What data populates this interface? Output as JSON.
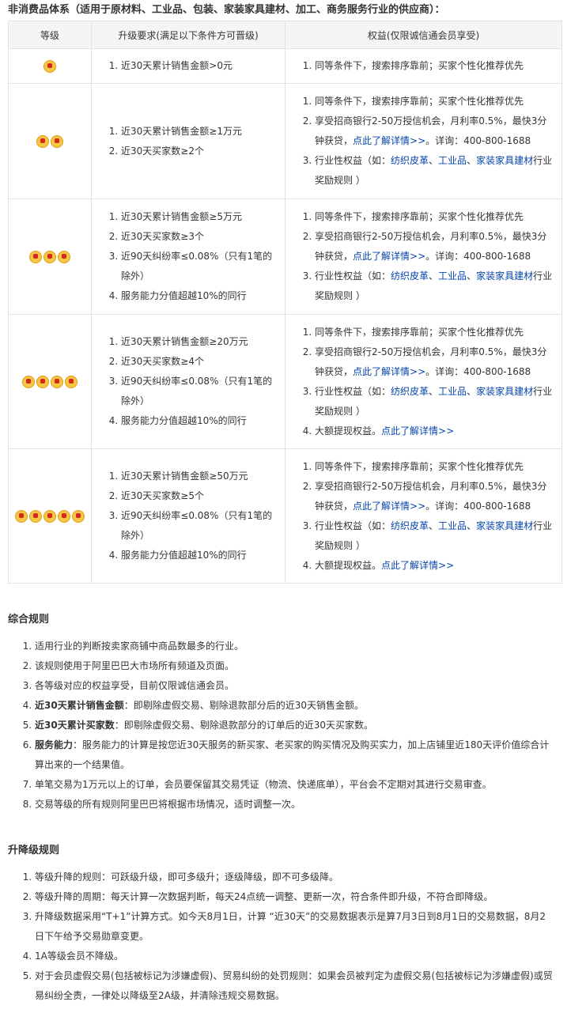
{
  "title": "非消费品体系（适用于原材料、工业品、包装、家装家具建材、加工、商务服务行业的供应商）：",
  "table": {
    "headers": [
      "等级",
      "升级要求(满足以下条件方可晋级)",
      "权益(仅限诚信通会员享受)"
    ],
    "rows": [
      {
        "crowns": 1,
        "requirements": [
          "近30天累计销售金额>0元"
        ],
        "benefits": [
          {
            "text": "同等条件下，搜索排序靠前；买家个性化推荐优先"
          }
        ]
      },
      {
        "crowns": 2,
        "requirements": [
          "近30天累计销售金额≥1万元",
          "近30天买家数≥2个"
        ],
        "benefits": [
          {
            "text": "同等条件下，搜索排序靠前；买家个性化推荐优先"
          },
          {
            "pre": "享受招商银行2-50万授信机会，月利率0.5%，最快3分钟获贷，",
            "link": "点此了解详情>>",
            "post": "。详询：400-800-1688"
          },
          {
            "pre": "行业性权益（如：",
            "links": [
              "纺织皮革",
              "工业品",
              "家装家具建材"
            ],
            "seps": [
              "、",
              "、"
            ],
            "post": "行业奖励规则 ）"
          }
        ]
      },
      {
        "crowns": 3,
        "requirements": [
          "近30天累计销售金额≥5万元",
          "近30天买家数≥3个",
          "近90天纠纷率≤0.08%（只有1笔的除外）",
          "服务能力分值超越10%的同行"
        ],
        "benefits": [
          {
            "text": "同等条件下，搜索排序靠前；买家个性化推荐优先"
          },
          {
            "pre": "享受招商银行2-50万授信机会，月利率0.5%，最快3分钟获贷，",
            "link": "点此了解详情>>",
            "post": "。详询：400-800-1688"
          },
          {
            "pre": "行业性权益（如：",
            "links": [
              "纺织皮革",
              "工业品",
              "家装家具建材"
            ],
            "seps": [
              "、",
              "、"
            ],
            "post": "行业奖励规则 ）"
          }
        ]
      },
      {
        "crowns": 4,
        "requirements": [
          "近30天累计销售金额≥20万元",
          "近30天买家数≥4个",
          "近90天纠纷率≤0.08%（只有1笔的除外）",
          "服务能力分值超越10%的同行"
        ],
        "benefits": [
          {
            "text": "同等条件下，搜索排序靠前；买家个性化推荐优先"
          },
          {
            "pre": "享受招商银行2-50万授信机会，月利率0.5%，最快3分钟获贷，",
            "link": "点此了解详情>>",
            "post": "。详询：400-800-1688"
          },
          {
            "pre": "行业性权益（如：",
            "links": [
              "纺织皮革",
              "工业品",
              "家装家具建材"
            ],
            "seps": [
              "、",
              "、"
            ],
            "post": "行业奖励规则 ）"
          },
          {
            "pre": "大额提现权益。",
            "link": "点此了解详情>>",
            "post": ""
          }
        ]
      },
      {
        "crowns": 5,
        "requirements": [
          "近30天累计销售金额≥50万元",
          "近30天买家数≥5个",
          "近90天纠纷率≤0.08%（只有1笔的除外）",
          "服务能力分值超越10%的同行"
        ],
        "benefits": [
          {
            "text": "同等条件下，搜索排序靠前；买家个性化推荐优先"
          },
          {
            "pre": "享受招商银行2-50万授信机会，月利率0.5%，最快3分钟获贷，",
            "link": "点此了解详情>>",
            "post": "。详询：400-800-1688"
          },
          {
            "pre": "行业性权益（如：",
            "links": [
              "纺织皮革",
              "工业品",
              "家装家具建材"
            ],
            "seps": [
              "、",
              "、"
            ],
            "post": "行业奖励规则 ）"
          },
          {
            "pre": "大额提现权益。",
            "link": "点此了解详情>>",
            "post": ""
          }
        ]
      }
    ]
  },
  "general_rules": {
    "heading": "综合规则",
    "items": [
      {
        "text": "适用行业的判断按卖家商铺中商品数最多的行业。"
      },
      {
        "text": "该规则使用于阿里巴巴大市场所有频道及页面。"
      },
      {
        "text": "各等级对应的权益享受，目前仅限诚信通会员。"
      },
      {
        "bold": "近30天累计销售金额",
        "text": "：即剔除虚假交易、剔除退款部分后的近30天销售金额。"
      },
      {
        "bold": "近30天累计买家数",
        "text": "：即剔除虚假交易、剔除退款部分的订单后的近30天买家数。"
      },
      {
        "bold": "服务能力",
        "text": "：服务能力的计算是按您近30天服务的新买家、老买家的购买情况及购买实力，加上店铺里近180天评价值综合计算出来的一个结果值。"
      },
      {
        "text": "单笔交易为1万元以上的订单，会员要保留其交易凭证（物流、快递底单），平台会不定期对其进行交易审查。"
      },
      {
        "text": "交易等级的所有规则阿里巴巴将根据市场情况，适时调整一次。"
      }
    ]
  },
  "upgrade_rules": {
    "heading": "升降级规则",
    "items": [
      {
        "text": "等级升降的规则：可跃级升级，即可多级升；逐级降级，即不可多级降。"
      },
      {
        "text": "等级升降的周期：每天计算一次数据判断，每天24点统一调整、更新一次，符合条件即升级，不符合即降级。"
      },
      {
        "text": "升降级数据采用“T+1”计算方式。如今天8月1日，计算 “近30天”的交易数据表示是算7月3日到8月1日的交易数据，8月2日下午给予交易勋章变更。"
      },
      {
        "text": "1A等级会员不降级。"
      },
      {
        "text": "对于会员虚假交易(包括被标记为涉嫌虚假)、贸易纠纷的处罚规则：如果会员被判定为虚假交易(包括被标记为涉嫌虚假)或贸易纠纷全责，一律处以降级至2A级，并清除违规交易数据。"
      }
    ]
  }
}
